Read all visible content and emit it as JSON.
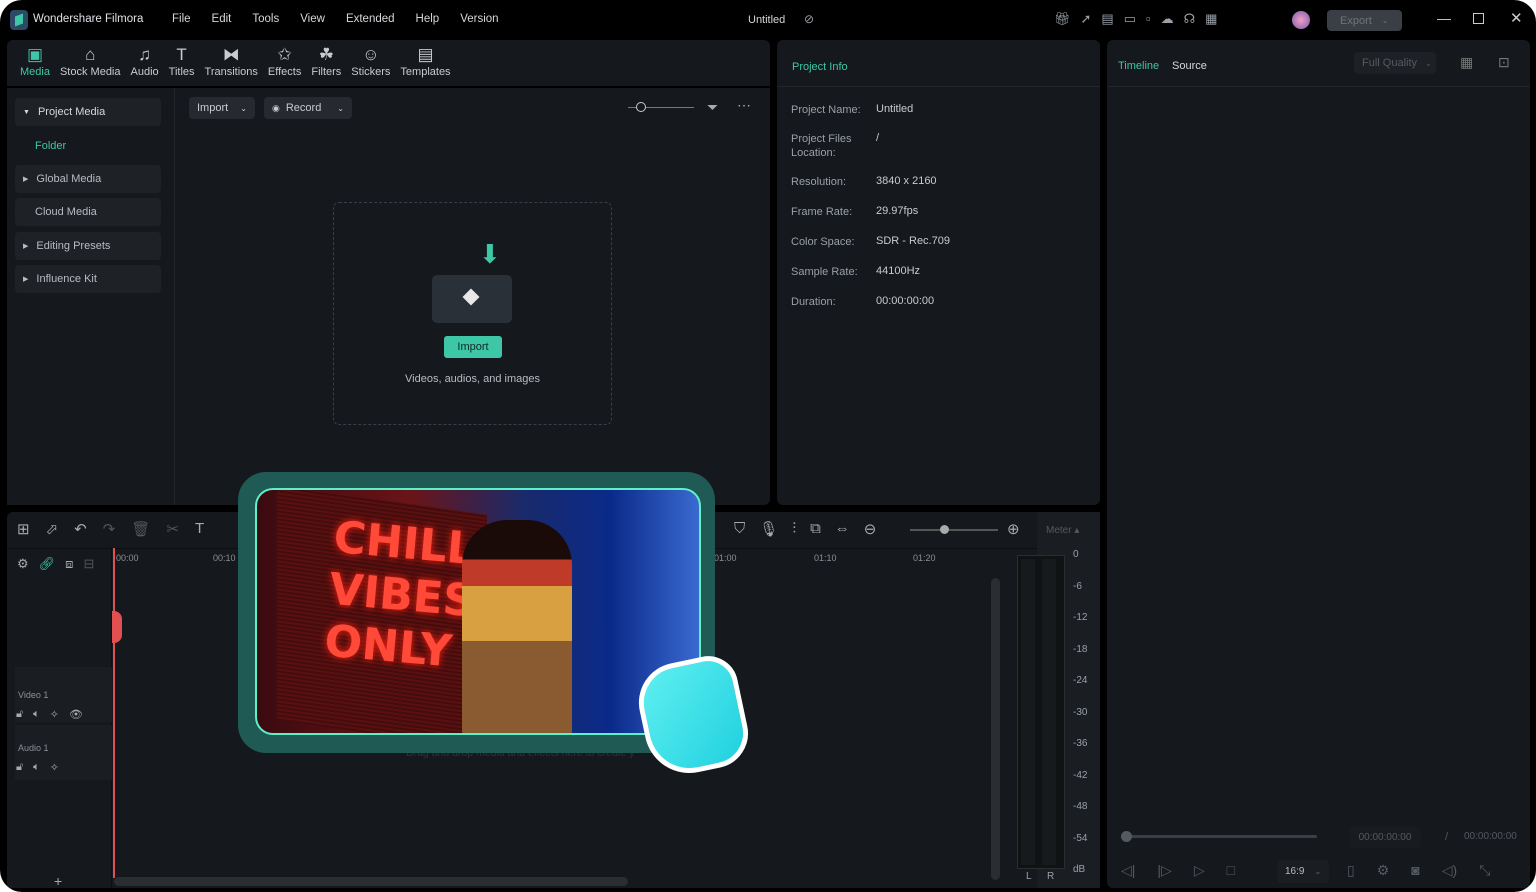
{
  "app": {
    "title": "Wondershare Filmora",
    "project_title": "Untitled",
    "export_label": "Export"
  },
  "menu": [
    "File",
    "Edit",
    "Tools",
    "View",
    "Extended",
    "Help",
    "Version"
  ],
  "toolbar": [
    {
      "label": "Media",
      "icon": "media-icon"
    },
    {
      "label": "Stock Media",
      "icon": "store-icon"
    },
    {
      "label": "Audio",
      "icon": "music-icon"
    },
    {
      "label": "Titles",
      "icon": "text-icon"
    },
    {
      "label": "Transitions",
      "icon": "transition-icon"
    },
    {
      "label": "Effects",
      "icon": "effects-icon"
    },
    {
      "label": "Filters",
      "icon": "filters-icon"
    },
    {
      "label": "Stickers",
      "icon": "sticker-icon"
    },
    {
      "label": "Templates",
      "icon": "template-icon"
    }
  ],
  "sidebar": {
    "items": [
      "Project Media",
      "Folder",
      "Global Media",
      "Cloud Media",
      "Editing Presets",
      "Influence Kit"
    ]
  },
  "media": {
    "import_label": "Import",
    "record_label": "Record",
    "drop_button": "Import",
    "drop_hint": "Videos, audios, and images"
  },
  "project_info": {
    "title": "Project Info",
    "rows": [
      {
        "k": "Project Name:",
        "v": "Untitled"
      },
      {
        "k": "Project Files Location:",
        "v": "/"
      },
      {
        "k": "Resolution:",
        "v": "3840 x 2160"
      },
      {
        "k": "Frame Rate:",
        "v": "29.97fps"
      },
      {
        "k": "Color Space:",
        "v": "SDR - Rec.709"
      },
      {
        "k": "Sample Rate:",
        "v": "44100Hz"
      },
      {
        "k": "Duration:",
        "v": "00:00:00:00"
      }
    ]
  },
  "preview": {
    "tab_timeline": "Timeline",
    "tab_source": "Source",
    "quality": "Full Quality",
    "current_time": "00:00:00:00",
    "separator": "/",
    "total_time": "00:00:00:00",
    "ratio": "16:9"
  },
  "timeline": {
    "ruler": [
      "00:00",
      "00:10",
      "01:00",
      "01:10",
      "01:20"
    ],
    "tracks": [
      "Video 1",
      "Audio 1"
    ],
    "drop_hint": "Drag and drop media and effects here to create y",
    "meter_label": "Meter",
    "meter_scale": [
      "0",
      "-6",
      "-12",
      "-18",
      "-24",
      "-30",
      "-36",
      "-42",
      "-48",
      "-54",
      "dB"
    ],
    "channels": [
      "L",
      "R"
    ],
    "add": "+"
  },
  "overlay": {
    "sign_text": [
      "CHILL",
      "VIBES",
      "ONLY"
    ]
  },
  "colors": {
    "accent": "#3ec7a6",
    "playhead": "#e05050",
    "overlay_frame": "#1f5a55",
    "hand": "#2ee0e0"
  }
}
